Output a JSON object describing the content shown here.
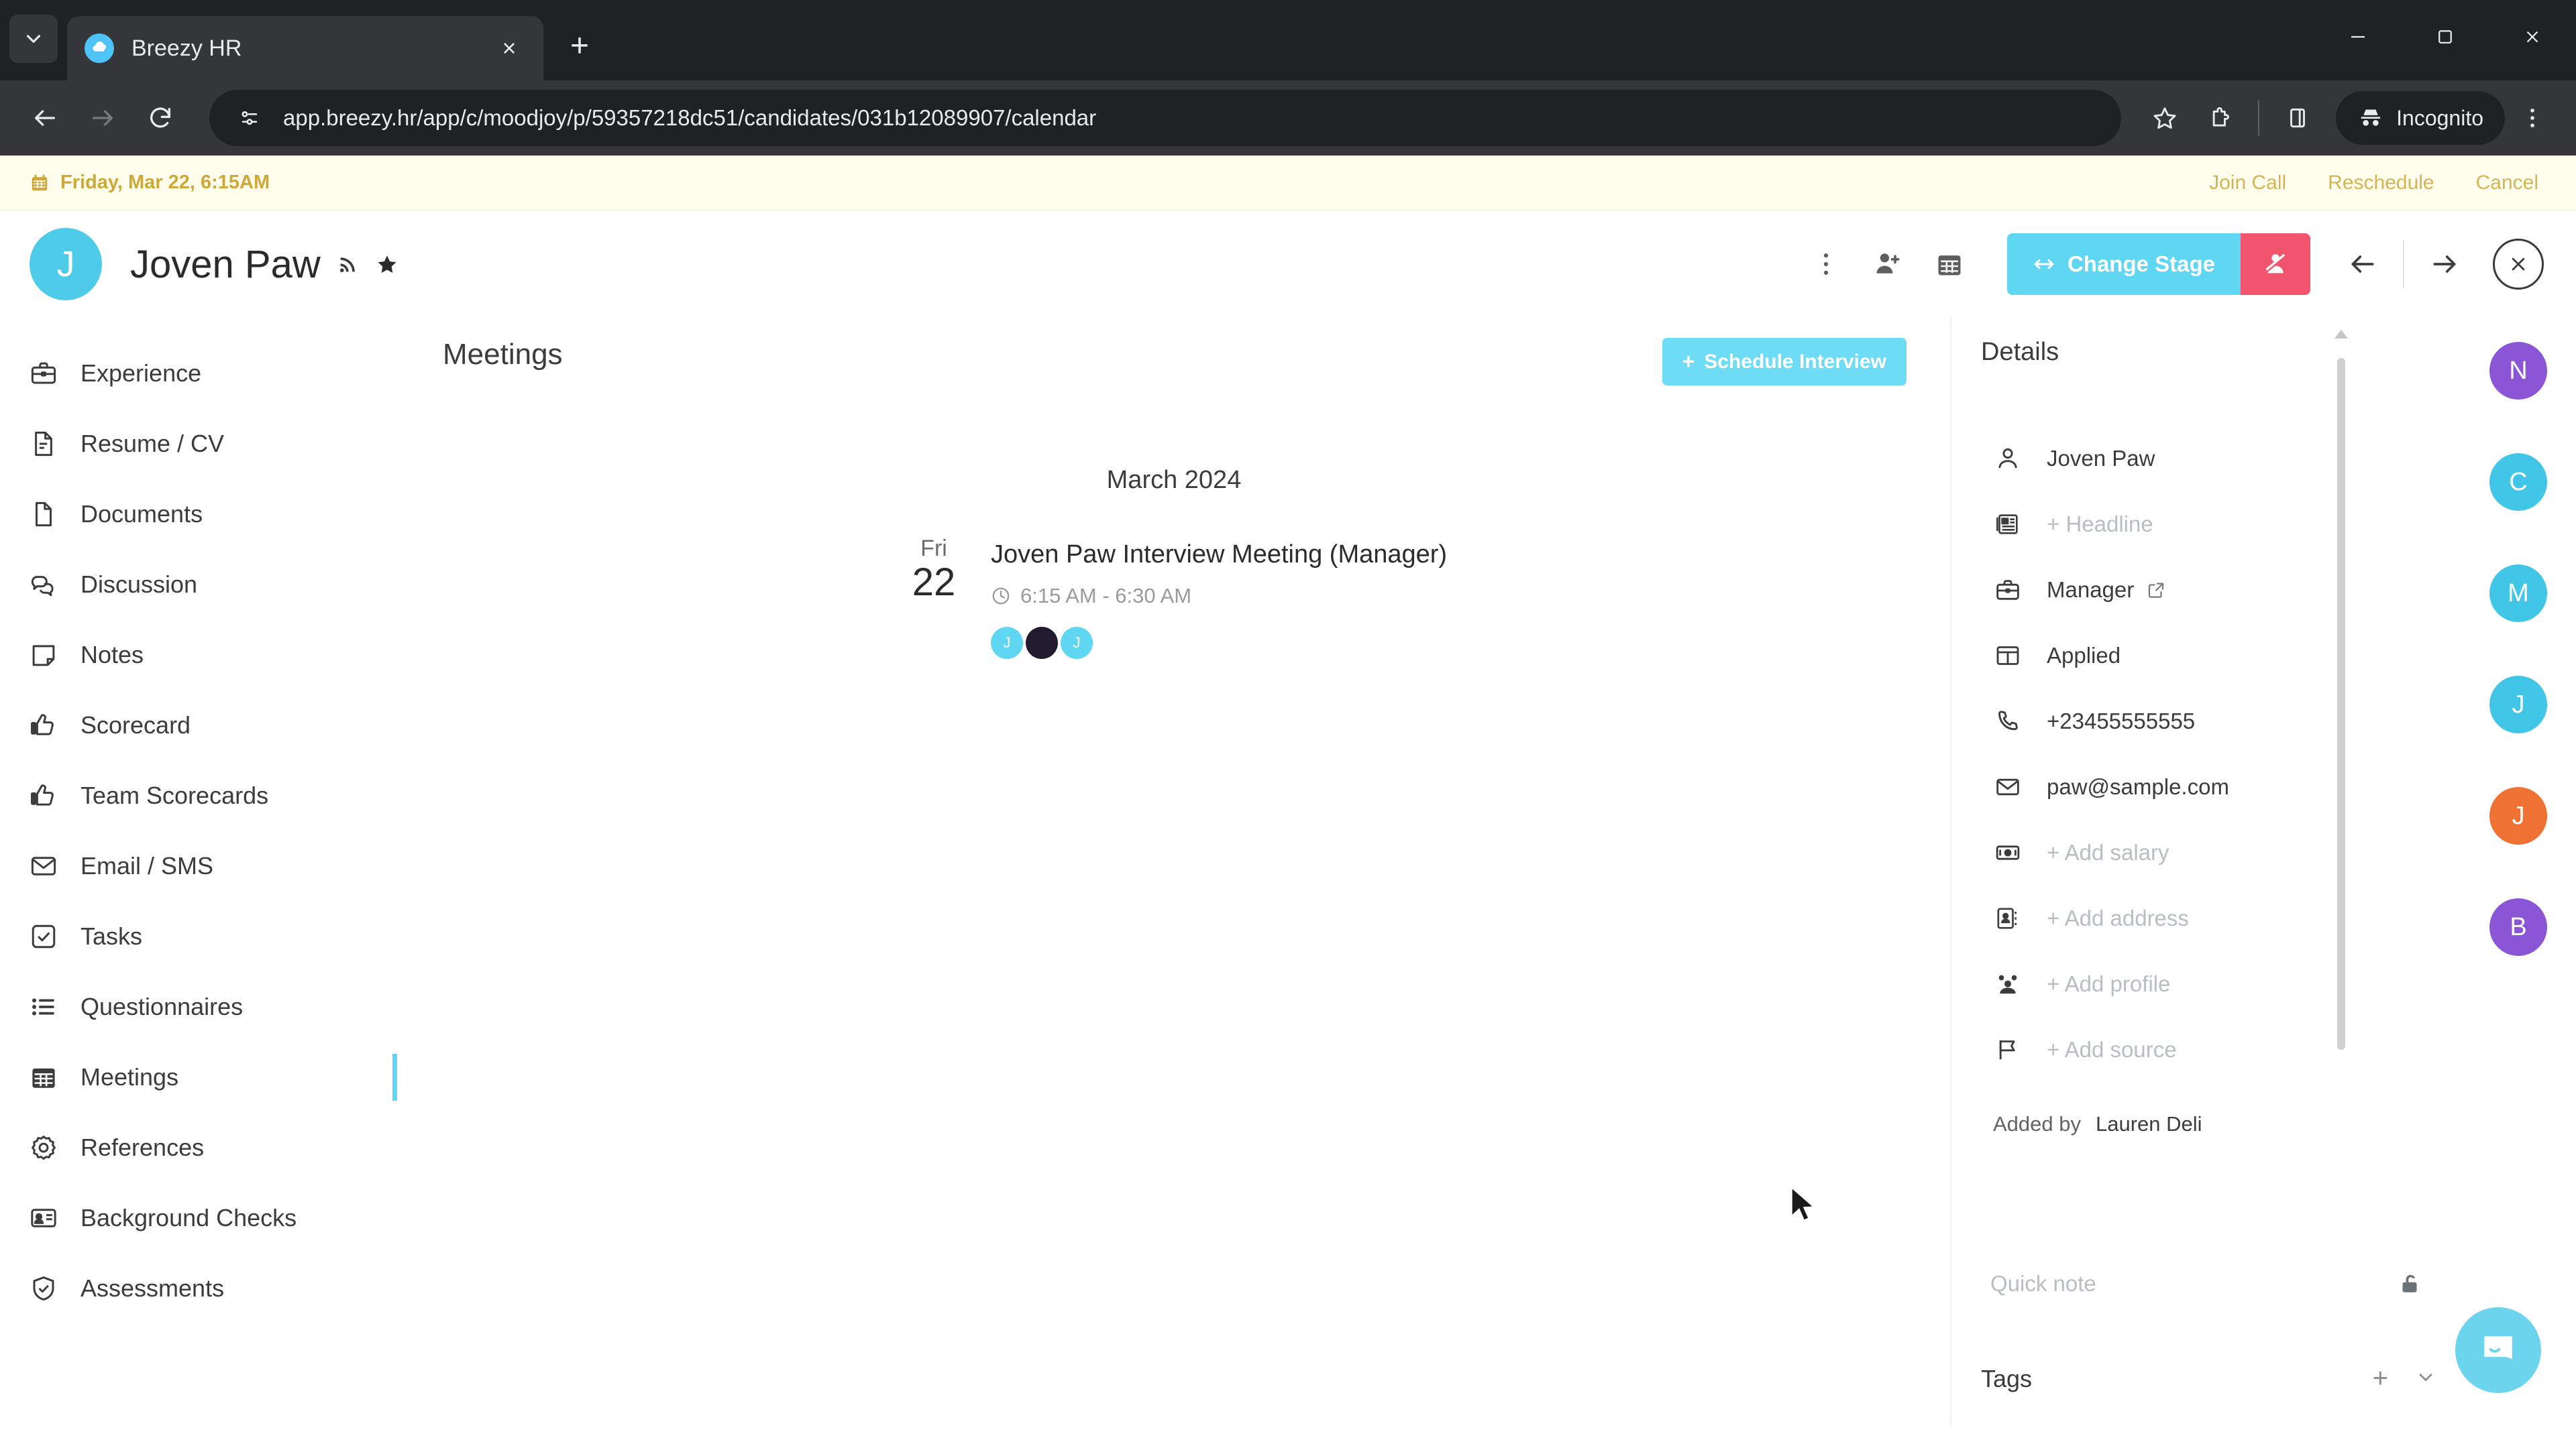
{
  "browser": {
    "tab": {
      "title": "Breezy HR",
      "favicon": "breezy-cloud-icon",
      "close": "×"
    },
    "new_tab": "+",
    "url": "app.breezy.hr/app/c/moodjoy/p/59357218dc51/candidates/031b12089907/calendar",
    "profile_label": "Incognito",
    "icons": {
      "back": "back-arrow-icon",
      "forward": "forward-arrow-icon",
      "reload": "reload-icon",
      "site_settings": "page-settings-icon",
      "bookmark": "star-icon",
      "extensions": "extensions-puzzle-icon",
      "side_panel": "side-panel-icon",
      "menu": "three-dot-menu-icon",
      "minimize": "minimize-icon",
      "maximize": "maximize-icon",
      "close_window": "close-window-icon",
      "tab_search": "tab-search-chevron-icon"
    }
  },
  "notification": {
    "date_text": "Friday, Mar 22, 6:15AM",
    "join_call": "Join Call",
    "reschedule": "Reschedule",
    "cancel": "Cancel",
    "accent": "#cfa83a",
    "background": "#fffdeb"
  },
  "candidate_header": {
    "avatar_initial": "J",
    "avatar_color": "#4ecbe8",
    "name": "Joven Paw",
    "change_stage_label": "Change Stage",
    "change_stage_color": "#5fd7f3",
    "reject_color": "#f2536d"
  },
  "sidebar": {
    "items": [
      {
        "label": "Experience",
        "icon": "briefcase-icon",
        "active": false
      },
      {
        "label": "Resume / CV",
        "icon": "document-lines-icon",
        "active": false
      },
      {
        "label": "Documents",
        "icon": "file-icon",
        "active": false
      },
      {
        "label": "Discussion",
        "icon": "chat-bubbles-icon",
        "active": false
      },
      {
        "label": "Notes",
        "icon": "note-icon",
        "active": false
      },
      {
        "label": "Scorecard",
        "icon": "thumbs-up-icon",
        "active": false
      },
      {
        "label": "Team Scorecards",
        "icon": "thumbs-up-icon",
        "active": false
      },
      {
        "label": "Email / SMS",
        "icon": "envelope-icon",
        "active": false
      },
      {
        "label": "Tasks",
        "icon": "checkbox-icon",
        "active": false
      },
      {
        "label": "Questionnaires",
        "icon": "list-icon",
        "active": false
      },
      {
        "label": "Meetings",
        "icon": "calendar-grid-icon",
        "active": true
      },
      {
        "label": "References",
        "icon": "gear-icon",
        "active": false
      },
      {
        "label": "Background Checks",
        "icon": "id-card-icon",
        "active": false
      },
      {
        "label": "Assessments",
        "icon": "shield-check-icon",
        "active": false
      }
    ]
  },
  "main": {
    "title": "Meetings",
    "schedule_button": "Schedule Interview",
    "schedule_plus": "+",
    "month_label": "March 2024",
    "meetings": [
      {
        "day_of_week": "Fri",
        "day": "22",
        "title": "Joven Paw Interview Meeting (Manager)",
        "time": "6:15 AM - 6:30 AM",
        "attendees": [
          {
            "initial": "J",
            "color": "#5fd7f3",
            "type": "initial"
          },
          {
            "initial": "",
            "color": "#221a2e",
            "type": "photo"
          },
          {
            "initial": "J",
            "color": "#5fd7f3",
            "type": "initial"
          }
        ]
      }
    ]
  },
  "details": {
    "title": "Details",
    "rows": [
      {
        "icon": "person-icon",
        "value": "Joven Paw",
        "muted": false,
        "external_link": false
      },
      {
        "icon": "headline-icon",
        "value": "+ Headline",
        "muted": true,
        "external_link": false
      },
      {
        "icon": "briefcase-icon",
        "value": "Manager",
        "muted": false,
        "external_link": true
      },
      {
        "icon": "board-columns-icon",
        "value": "Applied",
        "muted": false,
        "external_link": false
      },
      {
        "icon": "phone-icon",
        "value": "+23455555555",
        "muted": false,
        "external_link": false
      },
      {
        "icon": "envelope-icon",
        "value": "paw@sample.com",
        "muted": false,
        "external_link": false
      },
      {
        "icon": "money-icon",
        "value": "+ Add salary",
        "muted": true,
        "external_link": false
      },
      {
        "icon": "address-card-icon",
        "value": "+ Add address",
        "muted": true,
        "external_link": false
      },
      {
        "icon": "people-icon",
        "value": "+ Add profile",
        "muted": true,
        "external_link": false
      },
      {
        "icon": "flag-icon",
        "value": "+ Add source",
        "muted": true,
        "external_link": false
      }
    ],
    "added_by_label": "Added by",
    "added_by_name": "Lauren Deli",
    "quick_note_placeholder": "Quick note",
    "lock_icon": "unlock-icon",
    "tags_label": "Tags",
    "tags_add": "+",
    "tags_chevron": "chevron-down-icon"
  },
  "avatar_rail": [
    {
      "initial": "N",
      "color": "#8b56d6"
    },
    {
      "initial": "C",
      "color": "#41c6e8"
    },
    {
      "initial": "M",
      "color": "#41c6e8"
    },
    {
      "initial": "J",
      "color": "#41c6e8"
    },
    {
      "initial": "J",
      "color": "#ef7134"
    },
    {
      "initial": "B",
      "color": "#8b56d6"
    }
  ],
  "intercom": {
    "icon": "intercom-chat-icon",
    "color": "#6cd4ec"
  }
}
